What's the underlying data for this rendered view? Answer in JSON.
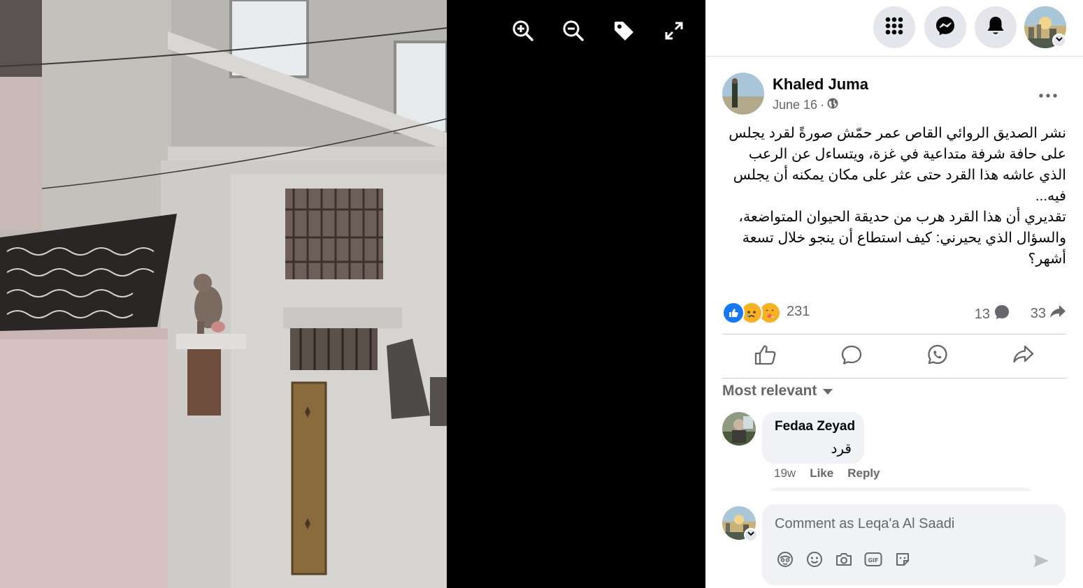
{
  "viewer": {
    "photo_alt": "",
    "tools": [
      {
        "icon": "zoom-in-icon"
      },
      {
        "icon": "zoom-out-icon"
      },
      {
        "icon": "tag-icon"
      },
      {
        "icon": "fullscreen-icon"
      }
    ]
  },
  "topbar": {
    "buttons": [
      {
        "icon": "menu-grid-icon"
      },
      {
        "icon": "messenger-icon"
      },
      {
        "icon": "notifications-bell-icon"
      }
    ],
    "account_caret_icon": "chevron-down-icon"
  },
  "post": {
    "author": "Khaled Juma",
    "date": "June 16",
    "separator": "·",
    "privacy_icon": "globe-icon",
    "text": "نشر الصديق الروائي القاص عمر حمّش صورةً لقرد يجلس على حافة شرفة متداعية في غزة، ويتساءل عن الرعب الذي عاشه هذا القرد حتى عثر على مكان يمكنه أن يجلس فيه...\nتقديري أن هذا القرد هرب من حديقة الحيوان المتواضعة، والسؤال الذي يحيرني: كيف استطاع أن ينجو خلال تسعة أشهر؟",
    "reactions": {
      "types": [
        "like",
        "sad",
        "care"
      ],
      "count": "231"
    },
    "comments_count": "13",
    "shares_count": "33",
    "actions": [
      {
        "icon": "like-icon"
      },
      {
        "icon": "comment-icon"
      },
      {
        "icon": "whatsapp-icon"
      },
      {
        "icon": "share-icon"
      }
    ]
  },
  "comments_section": {
    "sort_label": "Most relevant",
    "comments": [
      {
        "author": "Fedaa Zeyad",
        "text": "قرد",
        "age": "19w",
        "like_label": "Like",
        "reply_label": "Reply"
      }
    ]
  },
  "composer": {
    "placeholder": "Comment as Leqa'a Al Saadi",
    "tools": [
      {
        "icon": "avatar-sticker-icon"
      },
      {
        "icon": "emoji-icon"
      },
      {
        "icon": "camera-icon"
      },
      {
        "icon": "gif-icon"
      },
      {
        "icon": "sticker-icon"
      }
    ],
    "send_icon": "send-icon"
  },
  "colors": {
    "accent": "#1877f2",
    "secondary_text": "#65676b",
    "bubble_bg": "#f0f2f5",
    "button_bg": "#e4e6eb"
  }
}
